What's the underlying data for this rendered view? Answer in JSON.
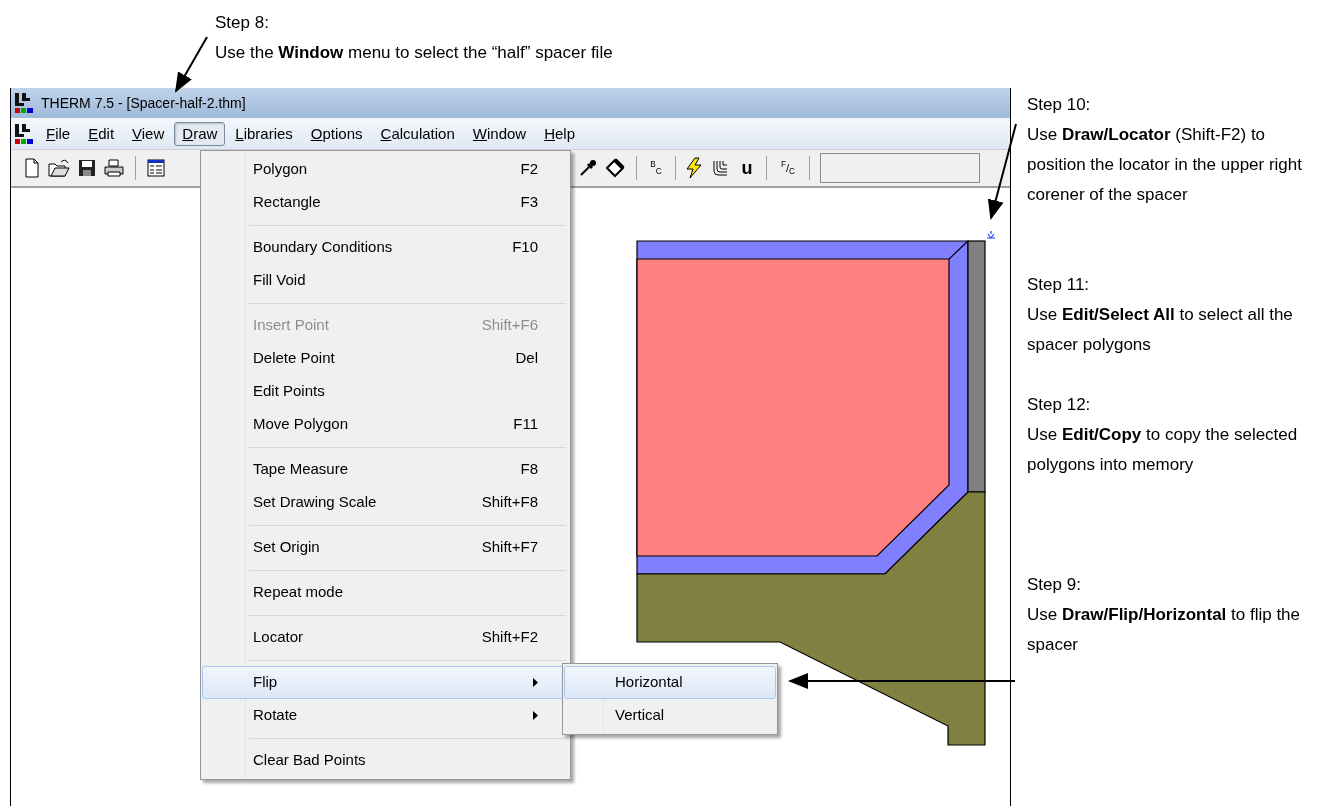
{
  "top_note": {
    "heading": "Step 8:",
    "text": "Use the **Window** menu to select the “half” spacer file"
  },
  "window": {
    "title": "THERM 7.5 - [Spacer-half-2.thm]"
  },
  "menu_bar": [
    {
      "label": "File",
      "selected": false
    },
    {
      "label": "Edit",
      "selected": false
    },
    {
      "label": "View",
      "selected": false
    },
    {
      "label": "Draw",
      "selected": true
    },
    {
      "label": "Libraries",
      "selected": false
    },
    {
      "label": "Options",
      "selected": false
    },
    {
      "label": "Calculation",
      "selected": false
    },
    {
      "label": "Window",
      "selected": false
    },
    {
      "label": "Help",
      "selected": false
    }
  ],
  "toolbar": {
    "glyph_buttons": [
      "$^{B}$$_{C}$",
      "u",
      "$^{F}$/$_{C}$"
    ]
  },
  "draw_menu": [
    {
      "kind": "item",
      "label": "Polygon",
      "shortcut": "F2",
      "disabled": false,
      "selected": false
    },
    {
      "kind": "item",
      "label": "Rectangle",
      "shortcut": "F3",
      "disabled": false,
      "selected": false
    },
    {
      "kind": "separator"
    },
    {
      "kind": "item",
      "label": "Boundary Conditions",
      "shortcut": "F10",
      "disabled": false,
      "selected": false
    },
    {
      "kind": "item",
      "label": "Fill Void",
      "disabled": false,
      "selected": false
    },
    {
      "kind": "separator"
    },
    {
      "kind": "item",
      "label": "Insert Point",
      "shortcut": "Shift+F6",
      "disabled": true,
      "selected": false
    },
    {
      "kind": "item",
      "label": "Delete Point",
      "shortcut": "Del",
      "disabled": false,
      "selected": false
    },
    {
      "kind": "item",
      "label": "Edit Points",
      "disabled": false,
      "selected": false
    },
    {
      "kind": "item",
      "label": "Move Polygon",
      "shortcut": "F11",
      "disabled": false,
      "selected": false
    },
    {
      "kind": "separator"
    },
    {
      "kind": "item",
      "label": "Tape Measure",
      "shortcut": "F8",
      "disabled": false,
      "selected": false
    },
    {
      "kind": "item",
      "label": "Set Drawing Scale",
      "shortcut": "Shift+F8",
      "disabled": false,
      "selected": false
    },
    {
      "kind": "separator"
    },
    {
      "kind": "item",
      "label": "Set Origin",
      "shortcut": "Shift+F7",
      "disabled": false,
      "selected": false
    },
    {
      "kind": "separator"
    },
    {
      "kind": "item",
      "label": "Repeat mode",
      "disabled": false,
      "selected": false
    },
    {
      "kind": "separator"
    },
    {
      "kind": "item",
      "label": "Locator",
      "shortcut": "Shift+F2",
      "disabled": false,
      "selected": false
    },
    {
      "kind": "separator"
    },
    {
      "kind": "submenu",
      "label": "Flip",
      "disabled": false,
      "selected": true
    },
    {
      "kind": "submenu",
      "label": "Rotate",
      "disabled": false,
      "selected": false
    },
    {
      "kind": "separator"
    },
    {
      "kind": "item",
      "label": "Clear Bad Points",
      "disabled": false,
      "selected": false
    }
  ],
  "flip_submenu": [
    {
      "label": "Horizontal",
      "selected": true
    },
    {
      "label": "Vertical",
      "selected": false
    }
  ],
  "side_notes": [
    {
      "heading": "Step 10:",
      "text": "Use **Draw/Locator** (Shift-F2) to position the locator in the upper right corener of the spacer"
    },
    {
      "heading": "Step 11:",
      "text": "Use **Edit/Select All** to select all the spacer polygons"
    },
    {
      "heading": "Step 12:",
      "text": "Use **Edit/Copy** to copy the selected polygons into memory"
    },
    {
      "heading": "Step 9:",
      "text": "Use **Draw/Flip/Horizontal** to flip the spacer"
    }
  ]
}
